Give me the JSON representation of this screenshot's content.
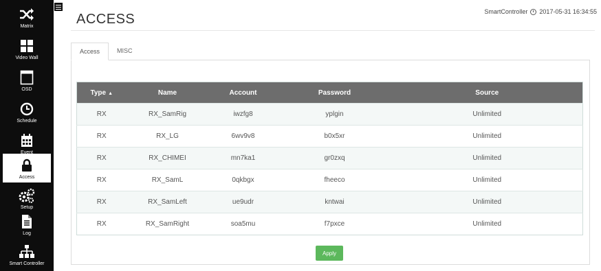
{
  "sidebar": {
    "items": [
      {
        "label": "Matrix",
        "icon": "shuffle-icon"
      },
      {
        "label": "Video Wall",
        "icon": "grid-icon"
      },
      {
        "label": "OSD",
        "icon": "window-icon"
      },
      {
        "label": "Schedule",
        "icon": "clock-icon"
      },
      {
        "label": "Event",
        "icon": "calendar-icon"
      },
      {
        "label": "Access",
        "icon": "lock-icon"
      },
      {
        "label": "Setup",
        "icon": "gears-icon"
      },
      {
        "label": "Log",
        "icon": "document-icon"
      },
      {
        "label": "Smart Controller",
        "icon": "sitemap-icon"
      }
    ],
    "active": "Access"
  },
  "header": {
    "title": "ACCESS",
    "device": "SmartController",
    "datetime": "2017-05-31 16:34:55"
  },
  "tabs": [
    {
      "label": "Access",
      "active": true
    },
    {
      "label": "MISC",
      "active": false
    }
  ],
  "table": {
    "columns": [
      "Type",
      "Name",
      "Account",
      "Password",
      "Source"
    ],
    "sort_column": "Type",
    "sort_indicator": "▲",
    "rows": [
      {
        "type": "RX",
        "name": "RX_SamRig",
        "account": "iwzfg8",
        "password": "yplgin",
        "source": "Unlimited"
      },
      {
        "type": "RX",
        "name": "RX_LG",
        "account": "6wv9v8",
        "password": "b0x5xr",
        "source": "Unlimited"
      },
      {
        "type": "RX",
        "name": "RX_CHIMEI",
        "account": "mn7ka1",
        "password": "gr0zxq",
        "source": "Unlimited"
      },
      {
        "type": "RX",
        "name": "RX_SamL",
        "account": "0qkbgx",
        "password": "fheeco",
        "source": "Unlimited"
      },
      {
        "type": "RX",
        "name": "RX_SamLeft",
        "account": "ue9udr",
        "password": "kntwai",
        "source": "Unlimited"
      },
      {
        "type": "RX",
        "name": "RX_SamRight",
        "account": "soa5mu",
        "password": "f7pxce",
        "source": "Unlimited"
      }
    ]
  },
  "actions": {
    "apply_label": "Apply"
  },
  "colors": {
    "sidebar_bg": "#0d0d0d",
    "table_header_bg": "#6d6d6d",
    "row_alt_bg": "#f4f8f7",
    "apply_bg": "#5cb85c"
  }
}
